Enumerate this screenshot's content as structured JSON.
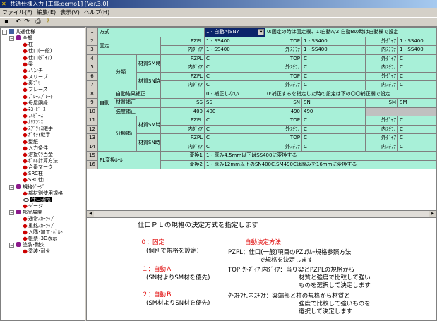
{
  "window": {
    "title": "共通仕様入力 [工事:demo1] [Ver.3.0]"
  },
  "menu": [
    "ファイル(F)",
    "編集(E)",
    "表示(V)",
    "ヘルプ(H)"
  ],
  "tree": {
    "root": "共通仕様",
    "groups": [
      {
        "label": "全般",
        "items": [
          "柱",
          "仕口(一般)",
          "仕口(ﾀﾞｲｱ)",
          "梁",
          "ハンチ",
          "スリーブ",
          "裏ﾌﾞﾘ",
          "ブレース",
          "ﾌﾞﾚｰｽﾌﾟﾚｰﾄ",
          "母屋胴縁",
          "ﾈｺ･ﾋﾟｰｽ",
          "ﾌﾙﾋﾟｰｽ",
          "ｶﾘｱﾗﾝｽ",
          "ｽﾌﾟﾗｲｽ継手",
          "ｶﾞｾｯﾄ継手",
          "型紙",
          "入力条件",
          "溶接ｳﾗ当金",
          "ﾎﾞﾙﾄ計算方法",
          "合番マーク",
          "SRC柱",
          "SRC仕口"
        ]
      },
      {
        "label": "規格ｹﾞｰｼﾞ",
        "items": [
          "部材別使用規格",
          "仕口規格",
          "ゲージ"
        ]
      },
      {
        "label": "部品展開",
        "items": [
          "通常ｽｶｰﾗｯﾌﾟ",
          "重銘ｽｶｰﾗｯﾌﾟ",
          "入隅･加工･ﾎﾞﾙﾄ",
          "帳票･3D表示"
        ]
      },
      {
        "label": "塗装･耐火",
        "items": [
          "塗装･耐火"
        ]
      }
    ],
    "selected": "仕口規格"
  },
  "grid": {
    "rows": [
      {
        "n": "1",
        "group": "方式",
        "sub": "",
        "sub2": "",
        "lbl1": "",
        "v1": "1 - 自動A(SN?",
        "lbl2": "",
        "v2": "0:固定の時は固定欄、1:自動A/2:自動Bの時は自動欄で設定",
        "lbl3": "",
        "v3": ""
      },
      {
        "n": "2",
        "group": "固定",
        "sub": "",
        "sub2": "",
        "lbl1": "PZPL",
        "v1": "1 - SS400",
        "lbl2": "TOP",
        "v2": "1 - SS400",
        "lbl3": "外ﾀﾞｲｱ",
        "v3": "1 - SS400"
      },
      {
        "n": "3",
        "group": "",
        "sub": "",
        "sub2": "",
        "lbl1": "内ﾀﾞｲｱ",
        "v1": "1 - SS400",
        "lbl2": "外ｽﾁﾌﾅ",
        "v2": "1 - SS400",
        "lbl3": "内ｽﾁﾌﾅ",
        "v3": "1 - SS400"
      },
      {
        "n": "4",
        "group": "",
        "sub": "分類",
        "sub2": "材質SM時",
        "lbl1": "PZPL",
        "v1": "C",
        "lbl2": "TOP",
        "v2": "C",
        "lbl3": "外ﾀﾞｲｱ",
        "v3": "C"
      },
      {
        "n": "5",
        "group": "",
        "sub": "",
        "sub2": "",
        "lbl1": "内ﾀﾞｲｱ",
        "v1": "C",
        "lbl2": "外ｽﾁﾌﾅ",
        "v2": "C",
        "lbl3": "内ｽﾁﾌﾅ",
        "v3": "C"
      },
      {
        "n": "6",
        "group": "",
        "sub": "",
        "sub2": "材質SN時",
        "lbl1": "PZPL",
        "v1": "C",
        "lbl2": "TOP",
        "v2": "C",
        "lbl3": "外ﾀﾞｲｱ",
        "v3": "C"
      },
      {
        "n": "7",
        "group": "",
        "sub": "",
        "sub2": "",
        "lbl1": "内ﾀﾞｲｱ",
        "v1": "C",
        "lbl2": "外ｽﾁﾌﾅ",
        "v2": "C",
        "lbl3": "内ｽﾁﾌﾅ",
        "v3": "C"
      },
      {
        "n": "8",
        "group": "",
        "sub": "自動結果補正",
        "sub2": "",
        "lbl1": "",
        "v1": "0 - 補正しない",
        "lbl2": "",
        "v2": "0:補正するを指定した時の設定は下の〇〇補正欄で設定",
        "lbl3": "",
        "v3": ""
      },
      {
        "n": "9",
        "group": "自動",
        "sub": "材質補正",
        "sub2": "",
        "lbl1": "SS",
        "v1": "SS",
        "lbl2": "SN",
        "v2": "SN",
        "lbl3": "SM",
        "v3": "SM"
      },
      {
        "n": "10",
        "group": "",
        "sub": "強度補正",
        "sub2": "",
        "lbl1": "400",
        "v1": "400",
        "lbl2": "490",
        "v2": "490",
        "lbl3": "",
        "v3": ""
      },
      {
        "n": "11",
        "group": "",
        "sub": "分類補正",
        "sub2": "材質SM時",
        "lbl1": "PZPL",
        "v1": "C",
        "lbl2": "TOP",
        "v2": "C",
        "lbl3": "外ﾀﾞｲｱ",
        "v3": "C"
      },
      {
        "n": "12",
        "group": "",
        "sub": "",
        "sub2": "",
        "lbl1": "内ﾀﾞｲｱ",
        "v1": "C",
        "lbl2": "外ｽﾁﾌﾅ",
        "v2": "C",
        "lbl3": "内ｽﾁﾌﾅ",
        "v3": "C"
      },
      {
        "n": "13",
        "group": "",
        "sub": "",
        "sub2": "材質SN時",
        "lbl1": "PZPL",
        "v1": "C",
        "lbl2": "TOP",
        "v2": "C",
        "lbl3": "外ﾀﾞｲｱ",
        "v3": "C"
      },
      {
        "n": "14",
        "group": "",
        "sub": "",
        "sub2": "",
        "lbl1": "内ﾀﾞｲｱ",
        "v1": "C",
        "lbl2": "外ｽﾁﾌﾅ",
        "v2": "C",
        "lbl3": "内ｽﾁﾌﾅ",
        "v3": "C"
      },
      {
        "n": "15",
        "group": "PL変換ﾙｰﾙ",
        "sub": "",
        "sub2": "",
        "lbl1": "変換1",
        "v1": "1 - 厚み4.5mm以下はSS400に変換する",
        "lbl2": "",
        "v2": "",
        "lbl3": "",
        "v3": ""
      },
      {
        "n": "16",
        "group": "",
        "sub": "",
        "sub2": "",
        "lbl1": "変換2",
        "v1": "1 - 厚み12mm以下のSN400C,SM490Cは厚みを16mmに変換する",
        "lbl2": "",
        "v2": "",
        "lbl3": "",
        "v3": ""
      }
    ]
  },
  "description": {
    "heading": "仕口ＰＬの規格の決定方式を指定します",
    "opt0_title": "０：固定",
    "opt0_sub": "(個別で規格を設定)",
    "opt1_title": "１：自動Ａ",
    "opt1_sub": "(SN材よりSM材を優先)",
    "opt2_title": "２：自動Ｂ",
    "opt2_sub": "(SM材よりSN材を優先)",
    "auto_title": "自動決定方法",
    "auto_l1": "PZPL：仕口(一般)項目のPZｺﾗﾑｰ規格参照方法",
    "auto_l2": "で規格を決定します",
    "auto_l3": "TOP,外ﾀﾞｲｱ,内ﾀﾞｲｱ：当り梁とPZPLの規格から",
    "auto_l4": "材質と強度で比較して強い",
    "auto_l5": "ものを選択して決定します",
    "auto_l6": "外ｽﾁﾌﾅ,内ｽﾁﾌﾅ：梁端部と柱の規格から材質と",
    "auto_l7": "強度で比較して強いものを",
    "auto_l8": "選択して決定します"
  }
}
